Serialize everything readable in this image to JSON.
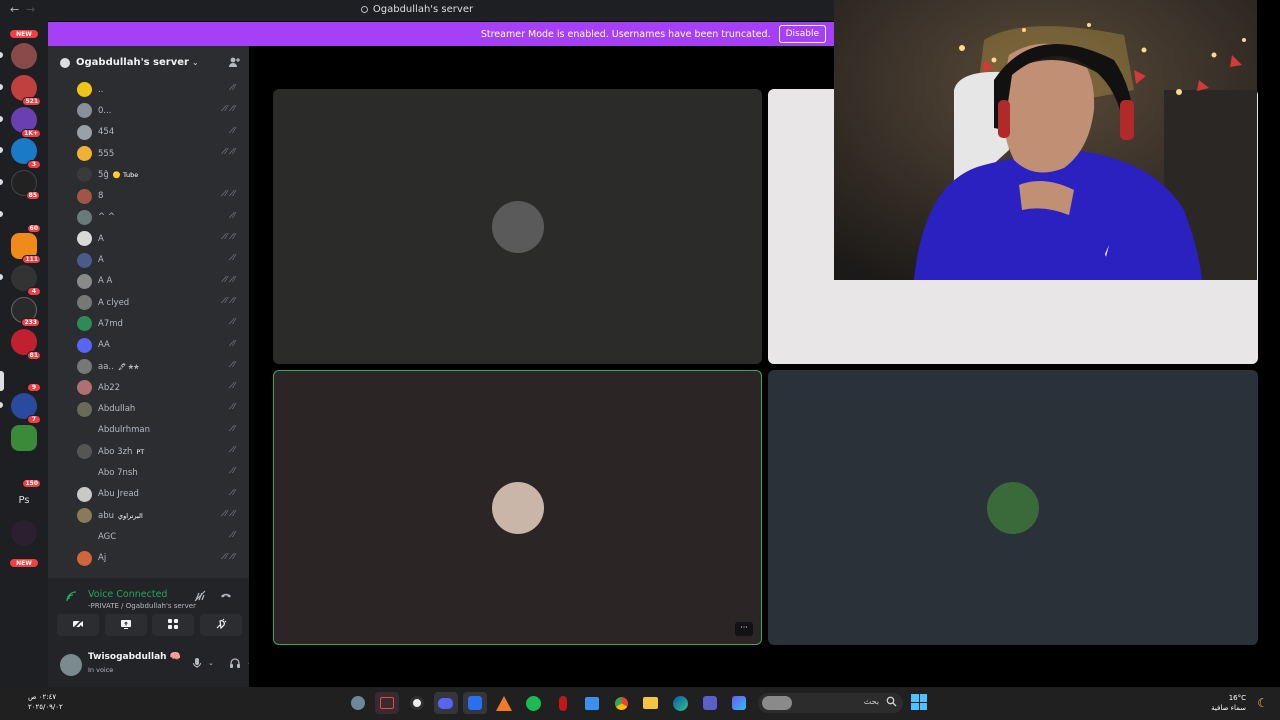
{
  "titlebar": {
    "title": "Ogabdullah's server",
    "back": "←",
    "forward": "→"
  },
  "banner": {
    "message": "Streamer Mode is enabled. Usernames have been truncated.",
    "button": "Disable"
  },
  "rail": {
    "new_top": "NEW",
    "new_bottom": "NEW",
    "ps_label": "Ps",
    "badges": [
      "521",
      "1K+",
      "3",
      "85",
      "60",
      "111",
      "4",
      "233",
      "81",
      "9",
      "7",
      "150"
    ]
  },
  "server": {
    "name": "Ogabdullah's server",
    "chevron": "⌄",
    "invite_icon": "add-member-icon"
  },
  "members": [
    {
      "name": "..",
      "tag": "",
      "color": "#f0c419",
      "status": "⁄̸"
    },
    {
      "name": "0...",
      "tag": "",
      "color": "#8a8f98",
      "status": "⁄̸ ⁄̸"
    },
    {
      "name": "454",
      "tag": "",
      "color": "#9aa0a6",
      "status": "⁄̸"
    },
    {
      "name": "555",
      "tag": "",
      "color": "#f0b232",
      "status": "⁄̸ ⁄̸"
    },
    {
      "name": "5ĝ",
      "tag": "🟡 Tube",
      "color": "#3a3a3a",
      "status": ""
    },
    {
      "name": "8",
      "tag": "",
      "color": "#a05545",
      "status": "⁄̸ ⁄̸"
    },
    {
      "name": "^ ^",
      "tag": "",
      "color": "#6a7a7a",
      "status": "⁄̸"
    },
    {
      "name": "A",
      "tag": "",
      "color": "#d9d9d9",
      "status": "⁄̸ ⁄̸"
    },
    {
      "name": "A",
      "tag": "",
      "color": "#4a5a8a",
      "status": "⁄̸"
    },
    {
      "name": "A A",
      "tag": "",
      "color": "#8a8a8a",
      "status": "⁄̸ ⁄̸"
    },
    {
      "name": "A clyed",
      "tag": "",
      "color": "#777",
      "status": "⁄̸ ⁄̸"
    },
    {
      "name": "A7md",
      "tag": "",
      "color": "#2e8b57",
      "status": "⁄̸"
    },
    {
      "name": "AA",
      "tag": "",
      "color": "#5865f2",
      "status": "⁄̸"
    },
    {
      "name": "aa..",
      "tag": "🖋 ✯✯",
      "color": "#777",
      "status": "⁄̸"
    },
    {
      "name": "Ab22",
      "tag": "",
      "color": "#b07070",
      "status": "⁄̸"
    },
    {
      "name": "Abdullah",
      "tag": "",
      "color": "#6a6a5a",
      "status": "⁄̸"
    },
    {
      "name": "Abdulrhman",
      "tag": "",
      "color": "#2b2d31",
      "status": "⁄̸"
    },
    {
      "name": "Abo 3zh",
      "tag": "PT",
      "color": "#555",
      "status": "⁄̸"
    },
    {
      "name": "Abo 7nsh",
      "tag": "",
      "color": "#2b2d31",
      "status": "⁄̸"
    },
    {
      "name": "Abu Jread",
      "tag": "",
      "color": "#c9c9c9",
      "status": "⁄̸"
    },
    {
      "name": "abu",
      "tag": "البرتراوي",
      "color": "#8a7a5a",
      "status": "⁄̸ ⁄̸"
    },
    {
      "name": "AGC",
      "tag": "",
      "color": "#2b2d31",
      "status": "⁄̸"
    },
    {
      "name": "Aj",
      "tag": "",
      "color": "#d0643c",
      "status": "⁄̸ ⁄̸"
    }
  ],
  "voice": {
    "title": "Voice Connected",
    "channel": "-PRIVATE / Ogabdullah's server",
    "buttons": [
      "camera-off-icon",
      "screen-share-icon",
      "activities-icon",
      "soundboard-icon"
    ]
  },
  "user": {
    "name": "Twisogabdullah",
    "badge": "🧠",
    "status": "In voice"
  },
  "tiles": [
    {
      "bg": "#2b2c2a",
      "avatar": "#5a5a5a",
      "speaking": false
    },
    {
      "bg": "#e8e6e6",
      "avatar": "",
      "speaking": false
    },
    {
      "bg": "#2b2526",
      "avatar": "#c9b6a8",
      "speaking": true,
      "more": "···"
    },
    {
      "bg": "#2b3138",
      "avatar": "#3a6a3a",
      "speaking": false
    }
  ],
  "taskbar": {
    "time": "٠٢:٤٧ ص",
    "date": "٢٠٢٥/٠٩/٠٢",
    "search": "بحث",
    "weather_temp": "16°C",
    "weather_desc": "سماء صافية"
  }
}
